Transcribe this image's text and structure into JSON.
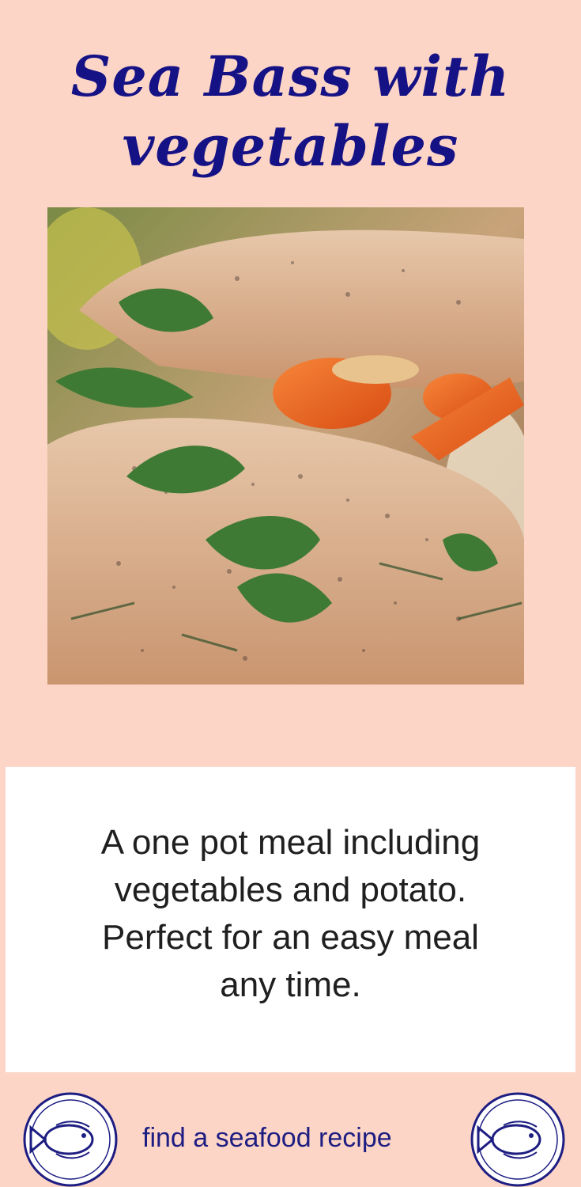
{
  "title": {
    "line1": "Sea Bass with",
    "line2": "vegetables"
  },
  "photo": {
    "subject": "sea bass fillets with carrots, herbs and parsley"
  },
  "description": {
    "line1": "A one pot meal including",
    "line2": "vegetables and potato.",
    "line3": "Perfect for an easy meal",
    "line4": "any time."
  },
  "footer": {
    "label": "find a seafood recipe",
    "logo_top": "find a",
    "logo_bottom": "seafood recipe"
  },
  "colors": {
    "background": "#fdd5c7",
    "title": "#151285",
    "footer_text": "#1d1d82",
    "card": "#ffffff"
  }
}
